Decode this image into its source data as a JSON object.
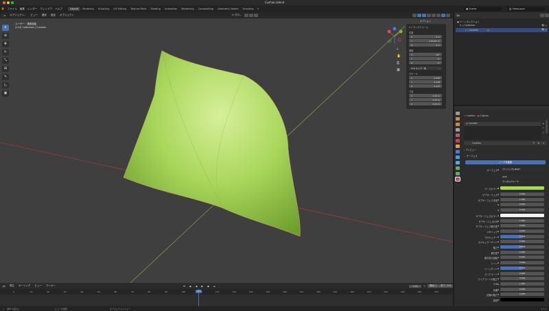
{
  "window": {
    "title": "Cushion.blend"
  },
  "menu": {
    "items": [
      "ファイル",
      "編集",
      "レンダー",
      "ウィンドウ",
      "ヘルプ"
    ]
  },
  "workspaces": [
    "Layout",
    "Modeling",
    "Sculpting",
    "UV Editing",
    "Texture Paint",
    "Shading",
    "Animation",
    "Rendering",
    "Compositing",
    "Geometry Nodes",
    "Scripting"
  ],
  "workspace_active": "Layout",
  "scene": {
    "scene_label": "Scene",
    "view_layer_label": "ViewLayer"
  },
  "viewport": {
    "header": {
      "mode": "オブジェクト...",
      "view": "ビュー",
      "select": "選択",
      "add": "追加",
      "object": "オブジェクト",
      "orientation": "グロ...",
      "options": "オプション"
    },
    "info_line1": "ユーザー・透視投影",
    "info_line2": "(110) Collection | Cushion"
  },
  "npanel": {
    "section": "トランスフォーム",
    "location_label": "位置",
    "location": [
      {
        "axis": "X",
        "value": "0 m"
      },
      {
        "axis": "Y",
        "value": "0.61163 m"
      },
      {
        "axis": "Z",
        "value": "0 m"
      }
    ],
    "rotation_label": "回転",
    "rotation": [
      {
        "axis": "X",
        "value": "90°"
      },
      {
        "axis": "Y",
        "value": "0°"
      },
      {
        "axis": "Z",
        "value": "0°"
      }
    ],
    "rotation_mode": "XYZ オイラー角",
    "scale_label": "スケール",
    "scale": [
      {
        "axis": "X",
        "value": "0.238"
      },
      {
        "axis": "Y",
        "value": "0.238"
      },
      {
        "axis": "Z",
        "value": "0.237"
      }
    ],
    "dimensions_label": "寸法",
    "dimensions": [
      {
        "axis": "X",
        "value": "0.45 m"
      },
      {
        "axis": "Y",
        "value": "0.45 m"
      },
      {
        "axis": "Z",
        "value": "0.25 m"
      }
    ]
  },
  "timeline": {
    "menus": [
      "再生",
      "キーイング",
      "ビュー",
      "マーカー"
    ],
    "current_frame": "110",
    "start_label": "開始",
    "start": "1",
    "end_label": "終了",
    "end": "250",
    "ticks": [
      "0",
      "10",
      "20",
      "30",
      "40",
      "50",
      "60",
      "70",
      "80",
      "90",
      "100",
      "110",
      "120",
      "130",
      "140",
      "150",
      "160",
      "170",
      "180",
      "190",
      "200",
      "210",
      "220",
      "230",
      "240",
      "250"
    ]
  },
  "status": {
    "left": "選択 (切替え)",
    "middle": "ビューを回転",
    "right": "オブジェクトメニュー",
    "version": "4.1.1"
  },
  "outliner": {
    "header": "シーンコレクション",
    "items": [
      {
        "label": "Collection",
        "depth": 1
      },
      {
        "label": "Cushion",
        "depth": 2
      }
    ]
  },
  "properties": {
    "breadcrumb_obj": "Cushion",
    "breadcrumb_mat": "Cushion",
    "material_slot": "Cushion",
    "material_name": "Cushion",
    "preview_label": "プレビュー",
    "surface_label": "サーフェス",
    "use_nodes_label": "ノードを使用",
    "surface_row": {
      "label": "サーフェス",
      "value": "プリンシプルBSDF"
    },
    "ggx": "GGX",
    "random_walk": "ランダムウォーク",
    "base_color_label": "ベースカラー",
    "rows": [
      {
        "label": "サブサーフェス",
        "value": "0.000",
        "hl": false
      },
      {
        "label": "サブサーフェス半径",
        "value": "1.000",
        "hl": false
      },
      {
        "label": "",
        "value": "0.200",
        "hl": false
      },
      {
        "label": "",
        "value": "0.100",
        "hl": false
      },
      {
        "label": "サブサーフェスカラー",
        "value": "",
        "hl": false,
        "swatch": true
      },
      {
        "label": "サブサーフェスIOR",
        "value": "1.400",
        "hl": false
      },
      {
        "label": "サブサーフェス異方性",
        "value": "0.000",
        "hl": false
      },
      {
        "label": "メタリック",
        "value": "0.000",
        "hl": false
      },
      {
        "label": "スペキュラー",
        "value": "0.500",
        "hl": true
      },
      {
        "label": "スペキュラーチント",
        "value": "0.000",
        "hl": false
      },
      {
        "label": "粗さ",
        "value": "0.500",
        "hl": true
      },
      {
        "label": "異方性",
        "value": "0.000",
        "hl": false
      },
      {
        "label": "異方性の回転",
        "value": "0.000",
        "hl": false
      },
      {
        "label": "シーン",
        "value": "0.000",
        "hl": false
      },
      {
        "label": "シーンチント",
        "value": "0.500",
        "hl": true
      },
      {
        "label": "クリアコート",
        "value": "0.000",
        "hl": false
      },
      {
        "label": "クリアコートの粗さ",
        "value": "0.030",
        "hl": false
      },
      {
        "label": "IOR",
        "value": "1.450",
        "hl": false
      },
      {
        "label": "伝播",
        "value": "0.000",
        "hl": false
      },
      {
        "label": "伝播の粗さ",
        "value": "0.000",
        "hl": false
      },
      {
        "label": "放射",
        "value": "",
        "hl": false,
        "black": true
      }
    ]
  }
}
